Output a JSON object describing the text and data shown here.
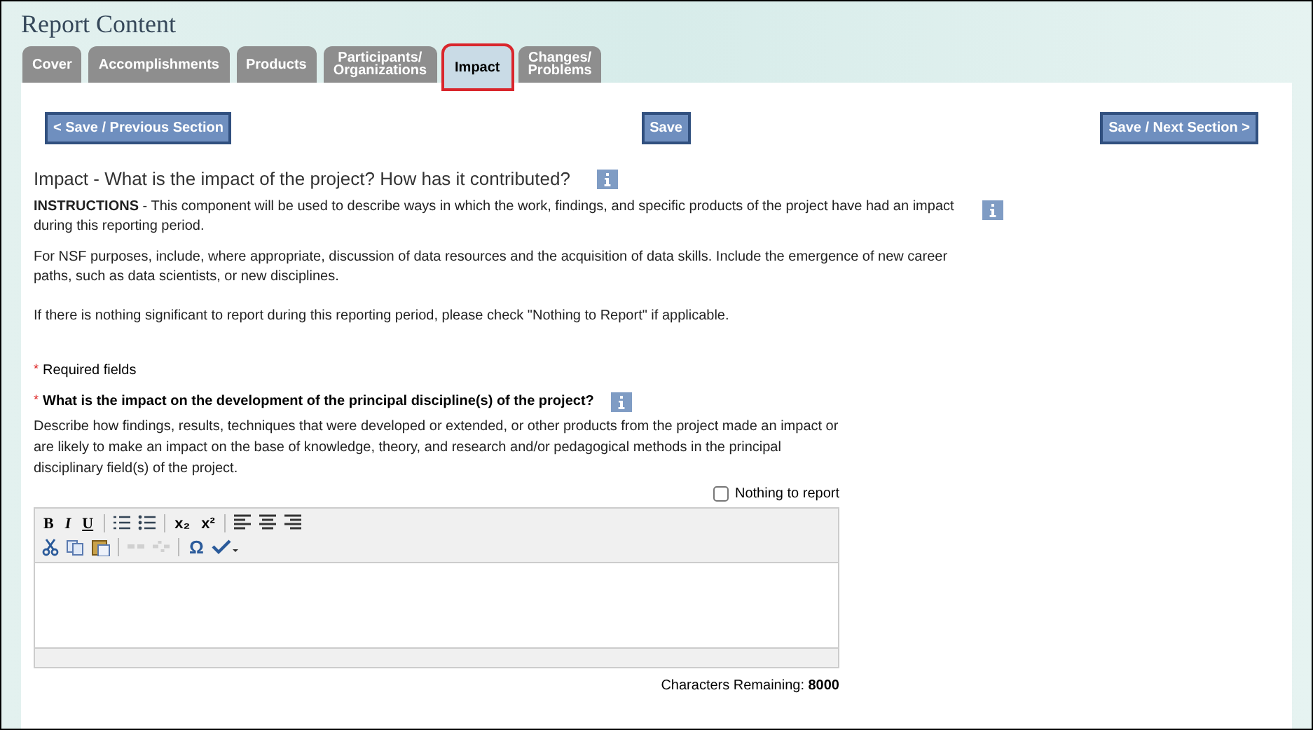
{
  "page_title": "Report Content",
  "tabs": [
    {
      "label": "Cover",
      "selected": false
    },
    {
      "label": "Accomplishments",
      "selected": false
    },
    {
      "label": "Products",
      "selected": false
    },
    {
      "label": "Participants/\nOrganizations",
      "selected": false
    },
    {
      "label": "Impact",
      "selected": true
    },
    {
      "label": "Changes/\nProblems",
      "selected": false
    }
  ],
  "nav_buttons": [
    "< Save / Previous Section",
    "Save",
    "Save / Next Section >"
  ],
  "section_heading": "Impact - What is the impact of the project? How has it contributed?",
  "instructions": [
    "**INSTRUCTIONS** - This component will be used to describe ways in which the work, findings, and specific products of the project have had an impact during this reporting period.",
    "For NSF purposes, include, where appropriate, discussion of data resources and the acquisition of data skills. Include the emergence of new career paths, such as data scientists, or new disciplines.",
    "If there is nothing significant to report during this reporting period, please check \"Nothing to Report\" if applicable."
  ],
  "required_note": {
    "marker": "*",
    "text": "Required fields"
  },
  "question": {
    "marker": "*",
    "text": "What is the impact on the development of the principal discipline(s) of the project?",
    "description": "Describe how findings, results, techniques that were developed or extended, or other products from the project made an impact or are likely to make an impact on the base of knowledge, theory, and research and/or pedagogical methods in the principal disciplinary field(s) of the project.",
    "nothing_to_report": {
      "label": "Nothing to report",
      "checked": false
    }
  },
  "toolbar": [
    [
      {
        "kind": "bold",
        "text": "B"
      },
      {
        "kind": "italic",
        "text": "I"
      },
      {
        "kind": "underline",
        "text": "U"
      },
      {
        "kind": "sep"
      },
      {
        "kind": "numbered-list"
      },
      {
        "kind": "bulleted-list"
      },
      {
        "kind": "sep"
      },
      {
        "kind": "subscript",
        "text": "x₂"
      },
      {
        "kind": "superscript",
        "text": "x²"
      },
      {
        "kind": "sep"
      },
      {
        "kind": "align-left"
      },
      {
        "kind": "align-center"
      },
      {
        "kind": "align-right"
      }
    ],
    [
      {
        "kind": "cut"
      },
      {
        "kind": "copy"
      },
      {
        "kind": "paste"
      },
      {
        "kind": "sep"
      },
      {
        "kind": "link",
        "disabled": true
      },
      {
        "kind": "unlink",
        "disabled": true
      },
      {
        "kind": "sep"
      },
      {
        "kind": "symbol",
        "text": "Ω"
      },
      {
        "kind": "spellcheck"
      }
    ]
  ],
  "characters_remaining": {
    "label": "Characters Remaining:",
    "value": "8000"
  }
}
